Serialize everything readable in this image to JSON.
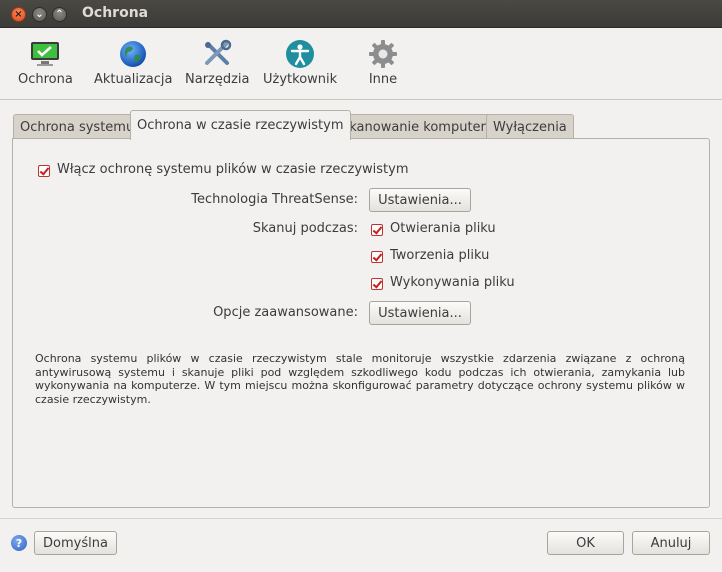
{
  "window": {
    "title": "Ochrona"
  },
  "toolbar": {
    "items": [
      {
        "label": "Ochrona",
        "icon": "monitor-check-icon"
      },
      {
        "label": "Aktualizacja",
        "icon": "globe-icon"
      },
      {
        "label": "Narzędzia",
        "icon": "tools-icon"
      },
      {
        "label": "Użytkownik",
        "icon": "accessibility-icon"
      },
      {
        "label": "Inne",
        "icon": "gear-icon"
      }
    ]
  },
  "tabs": [
    {
      "label": "Ochrona systemu",
      "active": false
    },
    {
      "label": "Ochrona w czasie rzeczywistym",
      "active": true
    },
    {
      "label": "Skanowanie komputera",
      "active": false
    },
    {
      "label": "Wyłączenia",
      "active": false
    }
  ],
  "panel": {
    "enable_label": "Włącz ochronę systemu plików w czasie rzeczywistym",
    "enable_checked": true,
    "threatsense_label": "Technologia ThreatSense:",
    "threatsense_button": "Ustawienia...",
    "scan_label": "Skanuj podczas:",
    "scan_options": [
      {
        "label": "Otwierania pliku",
        "checked": true
      },
      {
        "label": "Tworzenia pliku",
        "checked": true
      },
      {
        "label": "Wykonywania pliku",
        "checked": true
      }
    ],
    "advanced_label": "Opcje zaawansowane:",
    "advanced_button": "Ustawienia...",
    "description": "Ochrona systemu plików w czasie rzeczywistym stale monitoruje wszystkie zdarzenia związane z ochroną antywirusową systemu i skanuje pliki pod względem szkodliwego kodu podczas ich otwierania, zamykania lub wykonywania na komputerze. W tym miejscu można skonfigurować parametry dotyczące ochrony systemu plików w czasie rzeczywistym."
  },
  "footer": {
    "help_symbol": "?",
    "default_button": "Domyślna",
    "ok_button": "OK",
    "cancel_button": "Anuluj"
  },
  "colors": {
    "accent_red": "#c81e1e",
    "titlebar": "#3c3b37",
    "window_bg": "#f2f1f0"
  }
}
